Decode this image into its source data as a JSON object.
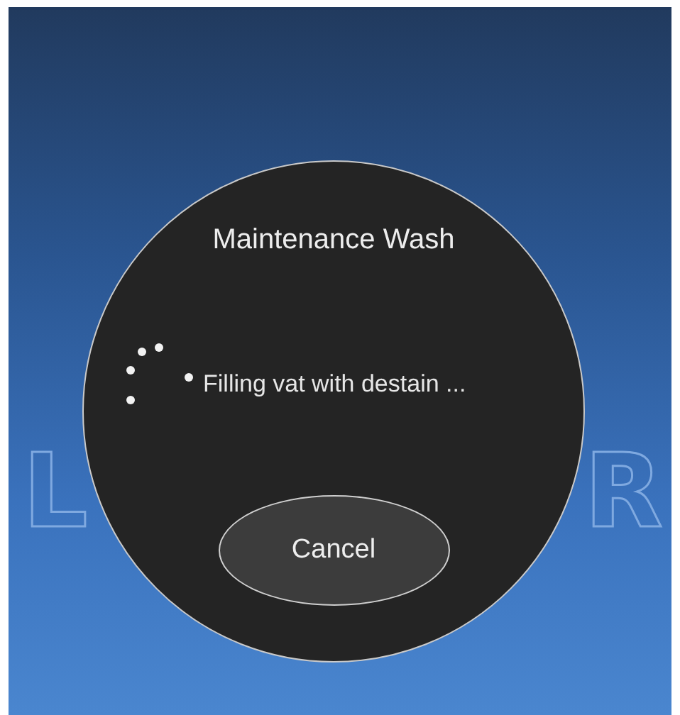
{
  "background_logo": {
    "left": "L",
    "right": "R"
  },
  "dialog": {
    "title": "Maintenance Wash",
    "status": "Filling vat with destain ...",
    "busy": true,
    "button": "Cancel"
  }
}
